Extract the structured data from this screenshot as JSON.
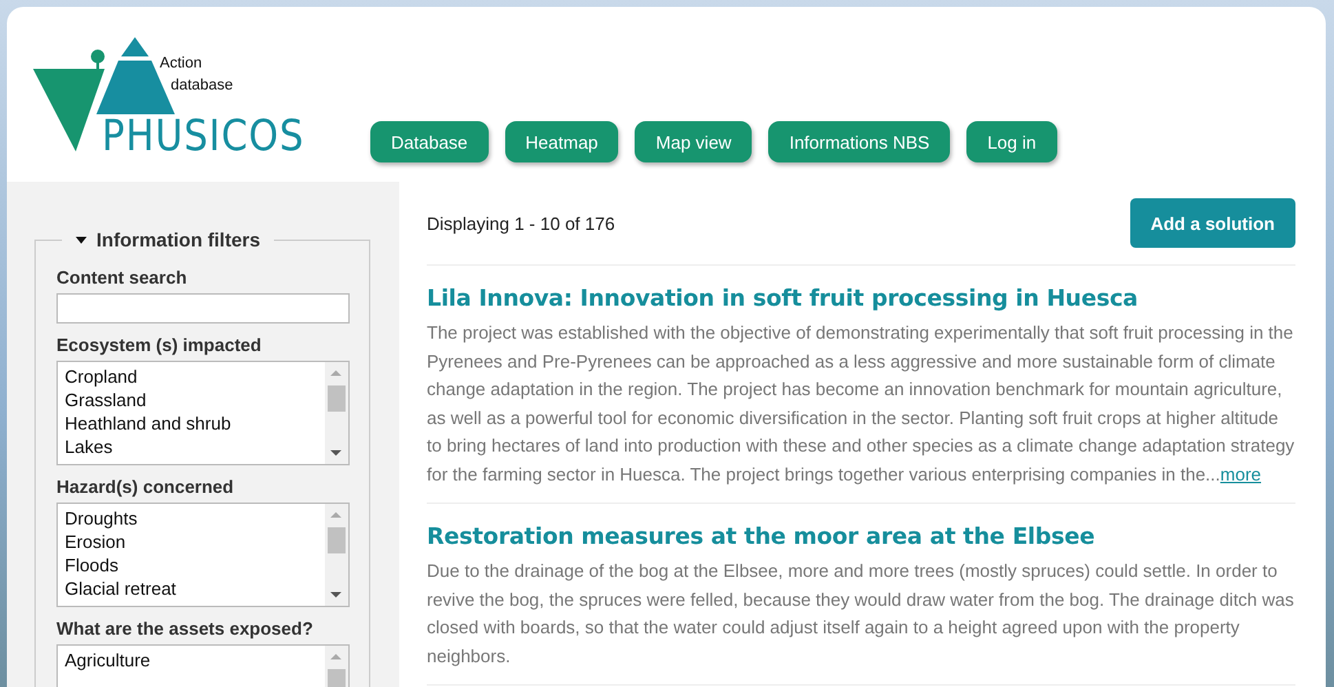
{
  "logo": {
    "caption_lines": [
      "Action",
      "database"
    ],
    "wordmark": "PHUSICOS"
  },
  "nav": [
    "Database",
    "Heatmap",
    "Map view",
    "Informations NBS",
    "Log in"
  ],
  "filters": {
    "legend": "Information filters",
    "expanded": true,
    "content_search": {
      "label": "Content search"
    },
    "lists": [
      {
        "label": "Ecosystem (s) impacted",
        "options": [
          "Cropland",
          "Grassland",
          "Heathland and shrub",
          "Lakes"
        ]
      },
      {
        "label": "Hazard(s) concerned",
        "options": [
          "Droughts",
          "Erosion",
          "Floods",
          "Glacial retreat"
        ]
      },
      {
        "label": "What are the assets exposed?",
        "options": [
          "Agriculture"
        ]
      }
    ]
  },
  "results": {
    "summary": "Displaying 1 - 10 of 176",
    "add_button": "Add a solution",
    "items": [
      {
        "title": "Lila Innova: Innovation in soft fruit processing in Huesca",
        "text": "The project was established with the objective of demonstrating experimentally that soft fruit processing in the Pyrenees and Pre-Pyrenees can be approached as a less aggressive and more sustainable form of climate change adaptation in the region. The project has become an innovation benchmark for mountain agriculture, as well as a powerful tool for economic diversification in the sector. Planting soft fruit crops at higher altitude to bring hectares of land into production with these and other species as a climate change adaptation strategy for the farming sector in Huesca. The project brings together various enterprising companies in the...",
        "more": "more"
      },
      {
        "title": "Restoration measures at the moor area at the Elbsee",
        "text": "Due to the drainage of the bog at the Elbsee, more and more trees (mostly spruces) could settle. In order to revive the bog, the spruces were felled, because they would draw water from the bog. The drainage ditch was closed with boards, so that the water could adjust itself again to a height agreed upon with the property neighbors."
      }
    ]
  }
}
